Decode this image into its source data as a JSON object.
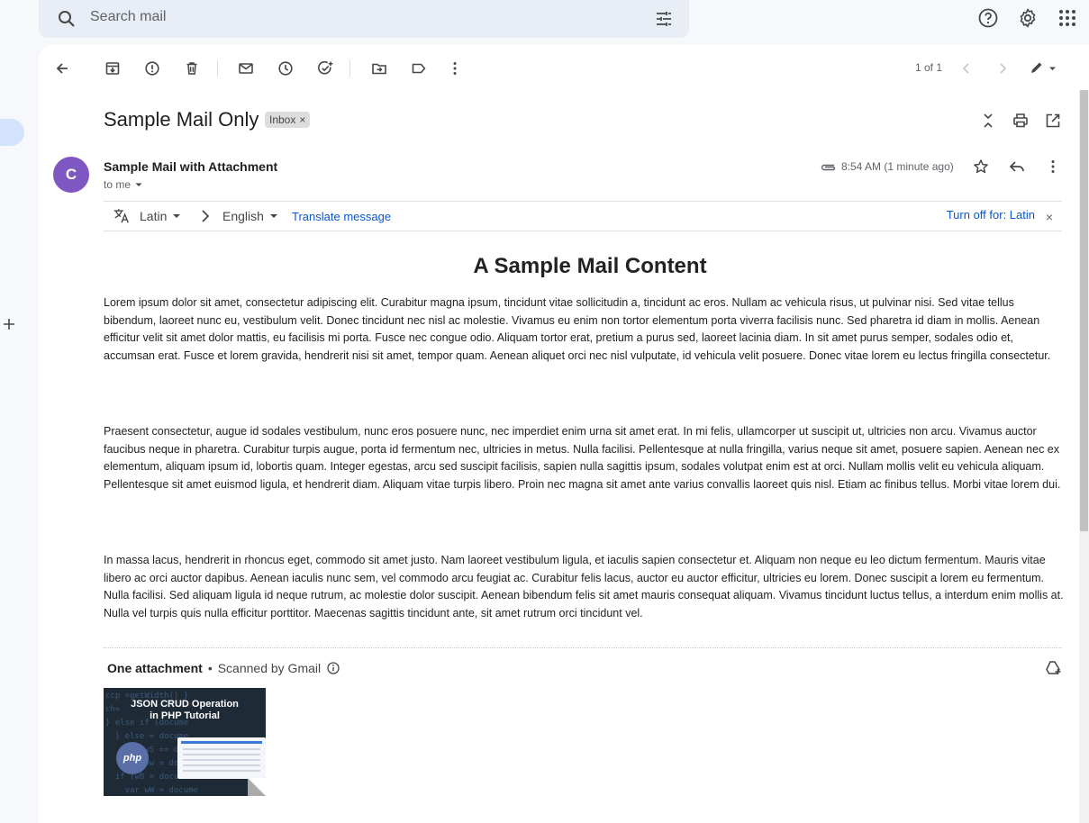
{
  "search": {
    "placeholder": "Search mail",
    "icon": "search-icon",
    "tune_icon": "tune-icon"
  },
  "top_right": {
    "help_icon": "help-icon",
    "settings_icon": "gear-icon",
    "apps_icon": "apps-grid-icon"
  },
  "toolbar": {
    "back_icon": "back-arrow-icon",
    "archive_icon": "archive-icon",
    "spam_icon": "report-spam-icon",
    "delete_icon": "delete-icon",
    "unread_icon": "mark-unread-icon",
    "snooze_icon": "snooze-icon",
    "task_icon": "add-task-icon",
    "move_icon": "move-to-icon",
    "label_icon": "label-icon",
    "more_icon": "more-vert-icon",
    "pager": "1 of 1",
    "prev_icon": "chevron-left-icon",
    "next_icon": "chevron-right-icon",
    "input_tools_icon": "pencil-icon"
  },
  "thread": {
    "subject": "Sample Mail Only",
    "label": "Inbox",
    "label_close": "×"
  },
  "message": {
    "avatar_letter": "C",
    "sender": "Sample Mail with Attachment",
    "to": "to me",
    "time": "8:54 AM (1 minute ago)"
  },
  "translate": {
    "from_lang": "Latin",
    "to_lang": "English",
    "translate_link": "Translate message",
    "turn_off": "Turn off for: Latin",
    "close": "×"
  },
  "body": {
    "title": "A Sample Mail Content",
    "paragraphs": [
      "Lorem ipsum dolor sit amet, consectetur adipiscing elit. Curabitur magna ipsum, tincidunt vitae sollicitudin a, tincidunt ac eros. Nullam ac vehicula risus, ut pulvinar nisi. Sed vitae tellus bibendum, laoreet nunc eu, vestibulum velit. Donec tincidunt nec nisl ac molestie. Vivamus eu enim non tortor elementum porta viverra facilisis nunc. Sed pharetra id diam in mollis. Aenean efficitur velit sit amet dolor mattis, eu facilisis mi porta. Fusce nec congue odio. Aliquam tortor erat, pretium a purus sed, laoreet lacinia diam. In sit amet purus semper, sodales odio et, accumsan erat. Fusce et lorem gravida, hendrerit nisi sit amet, tempor quam. Aenean aliquet orci nec nisl vulputate, id vehicula velit posuere. Donec vitae lorem eu lectus fringilla consectetur.",
      "Praesent consectetur, augue id sodales vestibulum, nunc eros posuere nunc, nec imperdiet enim urna sit amet erat. In mi felis, ullamcorper ut suscipit ut, ultricies non arcu. Vivamus auctor faucibus neque in pharetra. Curabitur turpis augue, porta id fermentum nec, ultricies in metus. Nulla facilisi. Pellentesque at nulla fringilla, varius neque sit amet, posuere sapien. Aenean nec ex elementum, aliquam ipsum id, lobortis quam. Integer egestas, arcu sed suscipit facilisis, sapien nulla sagittis ipsum, sodales volutpat enim est at orci. Nullam mollis velit eu vehicula aliquam. Pellentesque sit amet euismod ligula, et hendrerit diam. Aliquam vitae turpis libero. Proin nec magna sit amet ante varius convallis laoreet quis nisl. Etiam ac finibus tellus. Morbi vitae lorem dui.",
      "In massa lacus, hendrerit in rhoncus eget, commodo sit amet justo. Nam laoreet vestibulum ligula, et iaculis sapien consectetur et. Aliquam non neque eu leo dictum fermentum. Mauris vitae libero ac orci auctor dapibus. Aenean iaculis nunc sem, vel commodo arcu feugiat ac. Curabitur felis lacus, auctor eu auctor efficitur, ultricies eu lorem. Donec suscipit a lorem eu fermentum. Nulla facilisi. Sed aliquam ligula id neque rutrum, ac molestie dolor suscipit. Aenean bibendum felis sit amet mauris consequat aliquam. Vivamus tincidunt luctus tellus, a interdum enim mollis at. Nulla vel turpis quis nulla efficitur porttitor. Maecenas sagittis tincidunt ante, sit amet rutrum orci tincidunt vel."
    ]
  },
  "attachments": {
    "heading": "One attachment",
    "separator": "•",
    "scanned": "Scanned by Gmail",
    "thumbnail": {
      "title_line1": "JSON CRUD Operation",
      "title_line2": "in PHP Tutorial",
      "badge": "php"
    }
  },
  "colors": {
    "accent": "#0b57d0",
    "avatar": "#7e57c2",
    "panel": "#ffffff",
    "background": "#f6f8fc"
  }
}
